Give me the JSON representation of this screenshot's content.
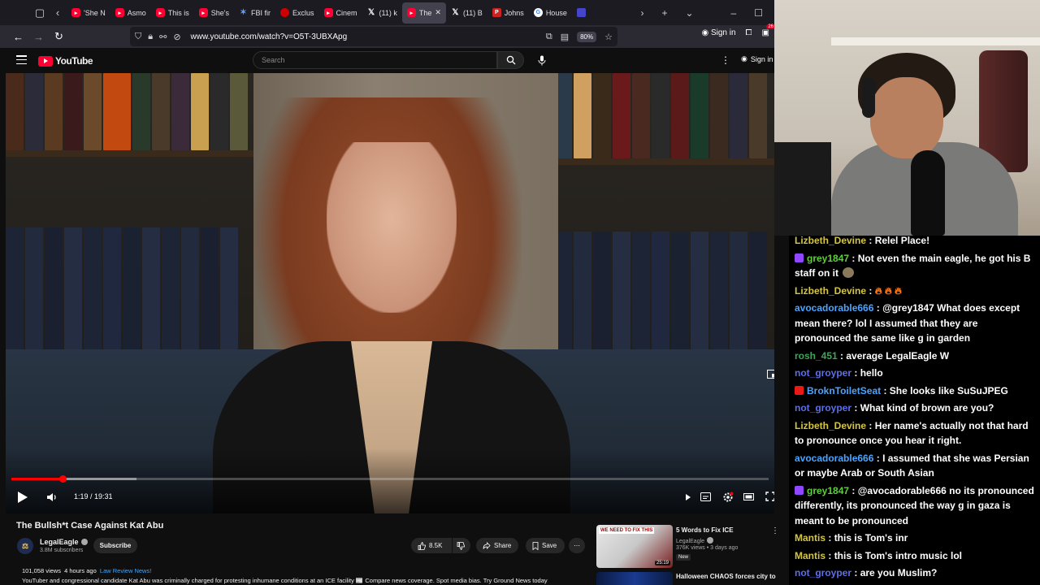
{
  "colors": {
    "accent": "#ff0033",
    "link": "#3ea6ff",
    "chat_bg": "#000000",
    "names": {
      "Lizbeth_Devine": "#d4c545",
      "grey1847": "#5fcf3a",
      "avocadorable666": "#4aa4ff",
      "rosh_451": "#3fa55a",
      "not_groyper": "#5d6ee8",
      "BroknToiletSeat": "#4aa4ff",
      "Mantis": "#d4c545"
    }
  },
  "browser": {
    "tabs": [
      {
        "fav": "yt",
        "icon": "youtube-icon",
        "label": "'She N"
      },
      {
        "fav": "yt",
        "icon": "youtube-icon",
        "label": "Asmo"
      },
      {
        "fav": "yt",
        "icon": "youtube-icon",
        "label": "This is"
      },
      {
        "fav": "yt",
        "icon": "youtube-icon",
        "label": "She's"
      },
      {
        "fav": "fbi",
        "icon": "fbi-icon",
        "label": "FBI fir"
      },
      {
        "fav": "cnn",
        "icon": "news-icon",
        "label": "Exclus"
      },
      {
        "fav": "yt",
        "icon": "youtube-icon",
        "label": "Cinem"
      },
      {
        "fav": "x",
        "icon": "x-icon",
        "label": "(11) k"
      },
      {
        "fav": "yt",
        "icon": "youtube-icon",
        "label": "The",
        "active": true
      },
      {
        "fav": "x",
        "icon": "x-icon",
        "label": "(11) B"
      },
      {
        "fav": "p",
        "icon": "politico-icon",
        "label": "Johns"
      },
      {
        "fav": "g",
        "icon": "google-icon",
        "label": "House"
      },
      {
        "fav": "w",
        "icon": "site-icon",
        "label": ""
      }
    ],
    "url": "www.youtube.com/watch?v=O5T-3UBXApg",
    "zoom": "80%",
    "signin": "Sign in",
    "notif_count": "26"
  },
  "youtube": {
    "logo_text": "YouTube",
    "search_placeholder": "Search",
    "header_signin": "Sign in",
    "player": {
      "time": "1:19 / 19:31",
      "progress_fraction": 0.0675,
      "buffer_fraction": 0.165
    },
    "video": {
      "title": "The Bullsh*t Case Against Kat Abu",
      "channel": "LegalEagle",
      "subs": "3.8M subscribers",
      "subscribe": "Subscribe",
      "likes": "8.5K",
      "share": "Share",
      "save": "Save",
      "views": "101,058 views",
      "age": "4 hours ago",
      "tag": "Law Review News!",
      "desc": "YouTuber and congressional candidate Kat Abu was criminally charged for protesting inhumane conditions at an ICE facility 📰 Compare news coverage. Spot media bias. Try Ground News today"
    },
    "recommended": [
      {
        "thumb_text": "WE NEED TO FIX THIS",
        "duration": "25:19",
        "title": "5 Words to Fix ICE",
        "channel": "LegalEagle",
        "meta": "376K views • 3 days ago",
        "badge": "New"
      },
      {
        "title": "Halloween CHAOS forces city to"
      }
    ]
  },
  "chat": [
    {
      "user": "Lizbeth_Devine",
      "badge": "",
      "text": "Relel Place!"
    },
    {
      "user": "grey1847",
      "badge": "sub",
      "text": "Not even the main eagle, he got his B staff on it",
      "emote": "rock"
    },
    {
      "user": "Lizbeth_Devine",
      "badge": "",
      "text": "",
      "emote": "fire"
    },
    {
      "user": "avocadorable666",
      "badge": "",
      "text": "@grey1847 What does except mean there? lol I assumed that they are pronounced the same like g in garden"
    },
    {
      "user": "rosh_451",
      "badge": "",
      "text": "average LegalEagle W"
    },
    {
      "user": "not_groyper",
      "badge": "",
      "text": "hello"
    },
    {
      "user": "BroknToiletSeat",
      "badge": "tw",
      "text": "She looks like SuSuJPEG"
    },
    {
      "user": "not_groyper",
      "badge": "",
      "text": "What kind of brown are you?"
    },
    {
      "user": "Lizbeth_Devine",
      "badge": "",
      "text": "Her name's actually not that hard to pronounce once you hear it right."
    },
    {
      "user": "avocadorable666",
      "badge": "",
      "text": "I assumed that she was Persian or maybe Arab or South Asian"
    },
    {
      "user": "grey1847",
      "badge": "sub",
      "text": "@avocadorable666 no its pronounced differently, its pronounced the way g in gaza is meant to be pronounced"
    },
    {
      "user": "Mantis",
      "badge": "",
      "text": "this is Tom's inr"
    },
    {
      "user": "Mantis",
      "badge": "",
      "text": "this is Tom's intro music lol"
    },
    {
      "user": "not_groyper",
      "badge": "",
      "text": "are you Muslim?"
    }
  ]
}
